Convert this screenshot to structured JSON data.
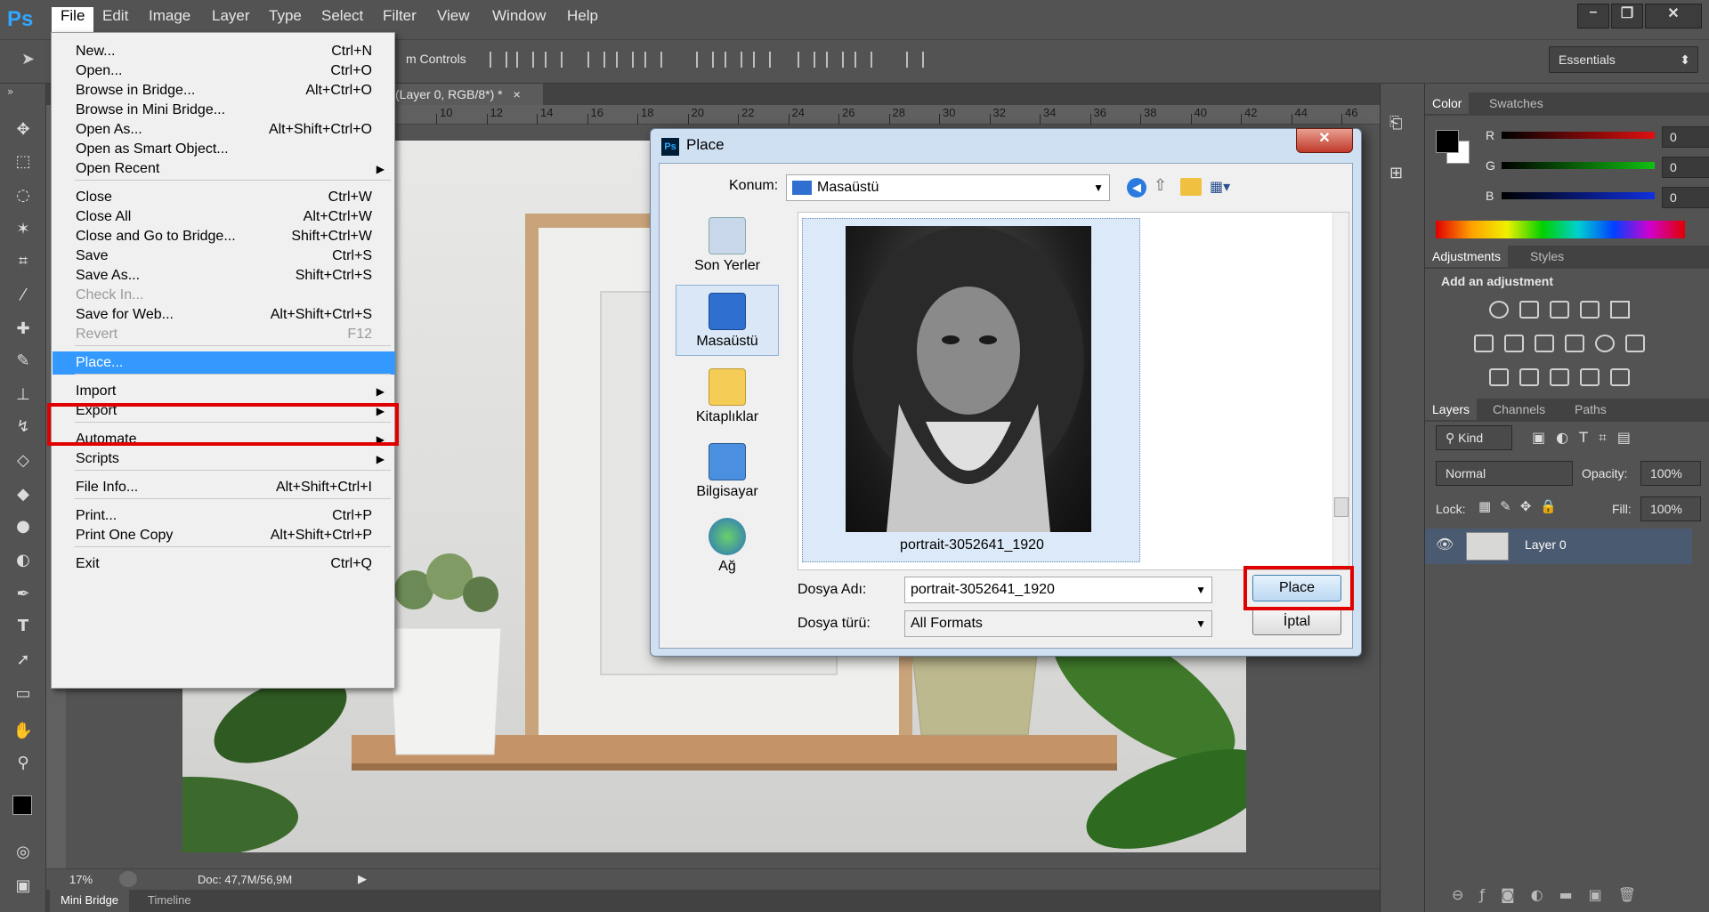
{
  "app": {
    "logo": "Ps",
    "menu": [
      "File",
      "Edit",
      "Image",
      "Layer",
      "Type",
      "Select",
      "Filter",
      "View",
      "Window",
      "Help"
    ],
    "active_menu": "File",
    "window_buttons": [
      "–",
      "❐",
      "✕"
    ]
  },
  "options_bar": {
    "text": "m Controls",
    "workspace": "Essentials"
  },
  "document": {
    "tab_label": "(Layer 0, RGB/8*) *",
    "tab_close": "×",
    "ruler_top": [
      "10",
      "12",
      "14",
      "16",
      "18",
      "20",
      "22",
      "24",
      "26",
      "28",
      "30",
      "32",
      "34",
      "36",
      "38",
      "40",
      "42",
      "44",
      "46"
    ],
    "zoom": "17%",
    "doc_info": "Doc: 47,7M/56,9M"
  },
  "bottom_tabs": [
    "Mini Bridge",
    "Timeline"
  ],
  "file_menu": {
    "items": [
      {
        "label": "New...",
        "shortcut": "Ctrl+N"
      },
      {
        "label": "Open...",
        "shortcut": "Ctrl+O"
      },
      {
        "label": "Browse in Bridge...",
        "shortcut": "Alt+Ctrl+O"
      },
      {
        "label": "Browse in Mini Bridge...",
        "shortcut": ""
      },
      {
        "label": "Open As...",
        "shortcut": "Alt+Shift+Ctrl+O"
      },
      {
        "label": "Open as Smart Object...",
        "shortcut": ""
      },
      {
        "label": "Open Recent",
        "shortcut": "",
        "submenu": "▶"
      },
      {
        "label": "Close",
        "shortcut": "Ctrl+W"
      },
      {
        "label": "Close All",
        "shortcut": "Alt+Ctrl+W"
      },
      {
        "label": "Close and Go to Bridge...",
        "shortcut": "Shift+Ctrl+W"
      },
      {
        "label": "Save",
        "shortcut": "Ctrl+S"
      },
      {
        "label": "Save As...",
        "shortcut": "Shift+Ctrl+S"
      },
      {
        "label": "Check In...",
        "shortcut": ""
      },
      {
        "label": "Save for Web...",
        "shortcut": "Alt+Shift+Ctrl+S"
      },
      {
        "label": "Revert",
        "shortcut": "F12"
      },
      {
        "label": "Place...",
        "shortcut": ""
      },
      {
        "label": "Import",
        "shortcut": "",
        "submenu": "▶"
      },
      {
        "label": "Export",
        "shortcut": "",
        "submenu": "▶"
      },
      {
        "label": "Automate",
        "shortcut": "",
        "submenu": "▶"
      },
      {
        "label": "Scripts",
        "shortcut": "",
        "submenu": "▶"
      },
      {
        "label": "File Info...",
        "shortcut": "Alt+Shift+Ctrl+I"
      },
      {
        "label": "Print...",
        "shortcut": "Ctrl+P"
      },
      {
        "label": "Print One Copy",
        "shortcut": "Alt+Shift+Ctrl+P"
      },
      {
        "label": "Exit",
        "shortcut": "Ctrl+Q"
      }
    ]
  },
  "place_dialog": {
    "title": "Place",
    "location_label": "Konum:",
    "location_value": "Masaüstü",
    "places": [
      "Son Yerler",
      "Masaüstü",
      "Kitaplıklar",
      "Bilgisayar",
      "Ağ"
    ],
    "selected_place": "Masaüstü",
    "file_name": "portrait-3052641_1920",
    "file_name_label": "Dosya Adı:",
    "file_type_label": "Dosya türü:",
    "file_type_value": "All Formats",
    "place_button": "Place",
    "cancel_button": "İptal",
    "close_glyph": "✕"
  },
  "panels": {
    "color_tabs": [
      "Color",
      "Swatches"
    ],
    "rgb": [
      {
        "ch": "R",
        "val": "0",
        "color": "#e01010"
      },
      {
        "ch": "G",
        "val": "0",
        "color": "#10c010"
      },
      {
        "ch": "B",
        "val": "0",
        "color": "#1030e0"
      }
    ],
    "adjust_tabs": [
      "Adjustments",
      "Styles"
    ],
    "adjust_title": "Add an adjustment",
    "layers_tabs": [
      "Layers",
      "Channels",
      "Paths"
    ],
    "kind": "Kind",
    "blend_mode": "Normal",
    "opacity_label": "Opacity:",
    "opacity": "100%",
    "lock_label": "Lock:",
    "fill_label": "Fill:",
    "fill": "100%",
    "layer_name": "Layer 0"
  }
}
